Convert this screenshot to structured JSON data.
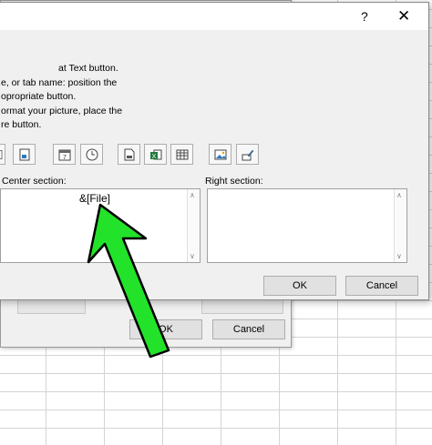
{
  "sheet": {
    "top_label_1": "",
    "top_label_2": ""
  },
  "back_dialog": {
    "ok_label": "OK",
    "cancel_label": "Cancel"
  },
  "dialog": {
    "help_label": "?",
    "close_label": "✕",
    "instructions": [
      "at Text button.",
      "e, or tab name:  position the",
      "opropriate button.",
      "ormat your picture, place the",
      "re button."
    ],
    "toolbar_icons": [
      "insert-page-number-icon",
      "insert-number-of-pages-icon",
      "insert-date-icon",
      "insert-time-icon",
      "insert-file-path-icon",
      "insert-file-name-icon",
      "insert-sheet-name-icon",
      "insert-picture-icon",
      "format-picture-icon"
    ],
    "center_section_label": "Center section:",
    "right_section_label": "Right section:",
    "center_section_value": "&[File]",
    "right_section_value": "",
    "ok_label": "OK",
    "cancel_label": "Cancel"
  },
  "annotation": {
    "arrow_color": "#22e32a"
  }
}
